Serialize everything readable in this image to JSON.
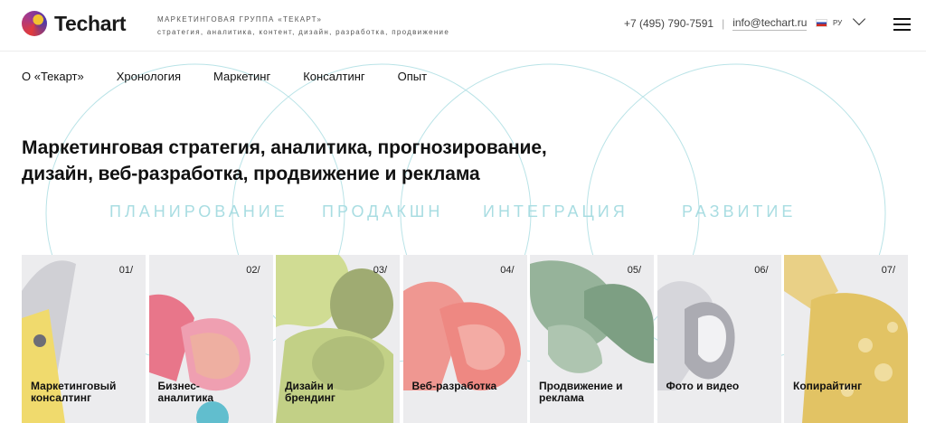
{
  "header": {
    "logo_text": "Techart",
    "tagline_line1": "Маркетинговая группа «Текарт»",
    "tagline_line2": "стратегия, аналитика, контент, дизайн, разработка, продвижение",
    "phone": "+7 (495) 790-7591",
    "separator": "|",
    "email": "info@techart.ru",
    "lang": "РУ"
  },
  "nav": [
    "О «Текарт»",
    "Хронология",
    "Маркетинг",
    "Консалтинг",
    "Опыт"
  ],
  "hero": {
    "headline_line1": "Маркетинговая стратегия, аналитика, прогнозирование,",
    "headline_line2": "дизайн, веб-разработка, продвижение и реклама"
  },
  "phases": [
    "ПЛАНИРОВАНИЕ",
    "ПРОДАКШН",
    "ИНТЕГРАЦИЯ",
    "РАЗВИТИЕ"
  ],
  "cards": [
    {
      "num": "01/",
      "line1": "Маркетинговый",
      "line2": "консалтинг"
    },
    {
      "num": "02/",
      "line1": "Бизнес-",
      "line2": "аналитика"
    },
    {
      "num": "03/",
      "line1": "Дизайн и",
      "line2": "брендинг"
    },
    {
      "num": "04/",
      "line1": "Веб-разработка",
      "line2": ""
    },
    {
      "num": "05/",
      "line1": "Продвижение и",
      "line2": "реклама"
    },
    {
      "num": "06/",
      "line1": "Фото и видео",
      "line2": ""
    },
    {
      "num": "07/",
      "line1": "Копирайтинг",
      "line2": ""
    }
  ],
  "colors": {
    "accent_circle": "#a9dde2",
    "card_bg": "#ececee",
    "text": "#111111"
  }
}
